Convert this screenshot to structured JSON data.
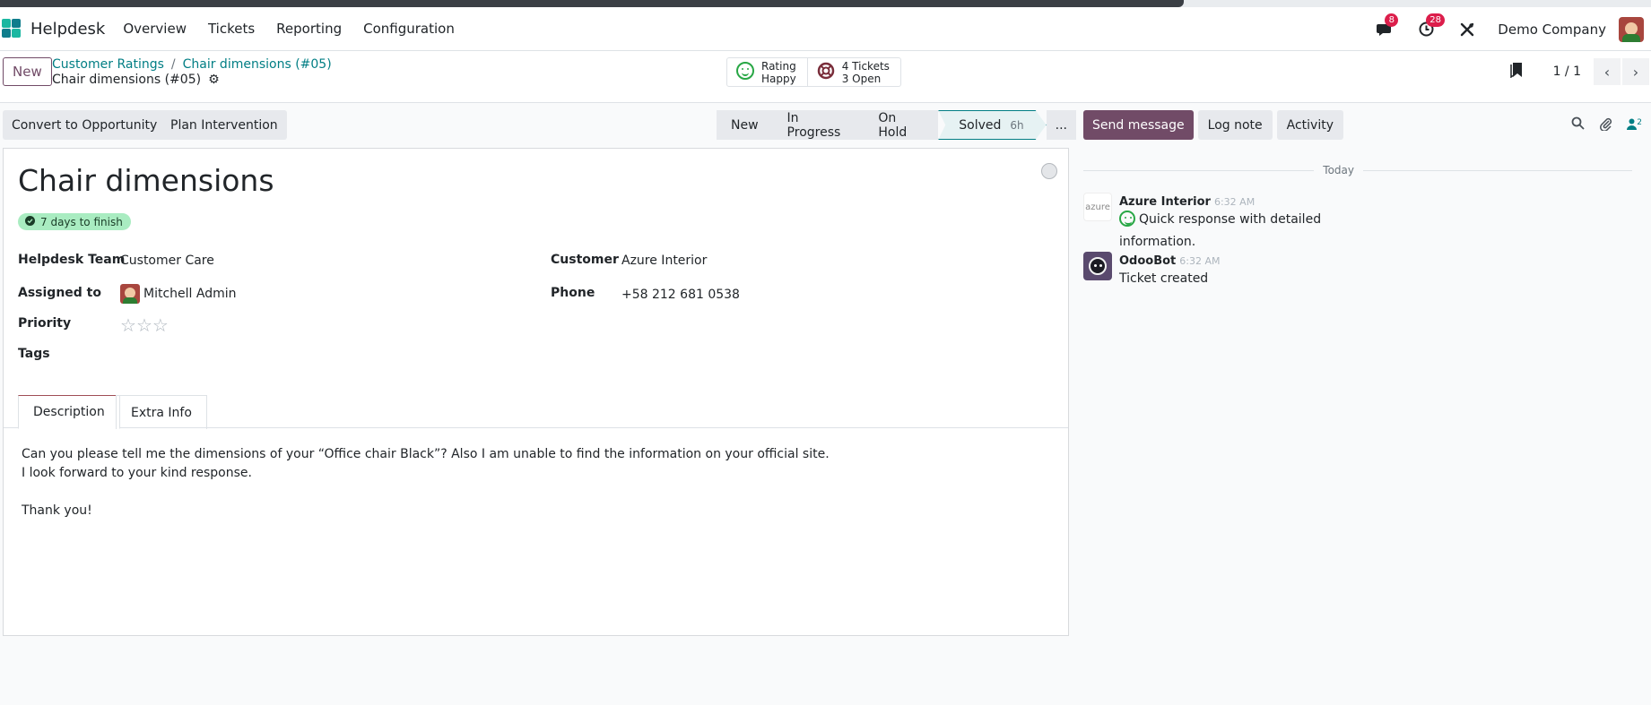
{
  "app": {
    "name": "Helpdesk"
  },
  "nav": {
    "items": [
      "Overview",
      "Tickets",
      "Reporting",
      "Configuration"
    ],
    "messages_badge": "8",
    "activities_badge": "28",
    "company": "Demo Company"
  },
  "control": {
    "new_label": "New",
    "breadcrumb": [
      "Customer Ratings",
      "Chair dimensions (#05)"
    ],
    "record_title": "Chair dimensions (#05)",
    "smart": {
      "rating_title": "Rating",
      "rating_value": "Happy",
      "tickets_title": "4 Tickets",
      "tickets_sub": "3 Open"
    },
    "pager": "1 / 1"
  },
  "actions": {
    "convert": "Convert to Opportunity",
    "plan": "Plan Intervention"
  },
  "stages": {
    "new": "New",
    "in_progress": "In Progress",
    "on_hold": "On Hold",
    "solved": "Solved",
    "solved_duration": "6h",
    "more": "..."
  },
  "chatter": {
    "send_message": "Send message",
    "log_note": "Log note",
    "activity": "Activity",
    "followers_count": "2",
    "today": "Today",
    "messages": [
      {
        "author": "Azure Interior",
        "time": "6:32 AM",
        "body": "Quick response with detailed information.",
        "avatar_text": "azure"
      },
      {
        "author": "OdooBot",
        "time": "6:32 AM",
        "body": "Ticket created"
      }
    ]
  },
  "ticket": {
    "name": "Chair dimensions",
    "sla": "7 days to finish",
    "labels": {
      "team": "Helpdesk Team",
      "assigned": "Assigned to",
      "priority": "Priority",
      "tags": "Tags",
      "customer": "Customer",
      "phone": "Phone"
    },
    "values": {
      "team": "Customer Care",
      "assigned": "Mitchell Admin",
      "customer": "Azure Interior",
      "phone": "+58 212 681 0538"
    },
    "priority_stars": 0,
    "tabs": [
      "Description",
      "Extra Info"
    ],
    "description": [
      "Can you please tell me the dimensions of your “Office chair Black”? Also I am unable to find the information on your official site.",
      "I look forward to your kind response.",
      "",
      "Thank you!"
    ]
  },
  "colors": {
    "brand": "#714b67",
    "link": "#017e84",
    "badge": "#dc1e4b",
    "sla": "#a9ecc1"
  }
}
